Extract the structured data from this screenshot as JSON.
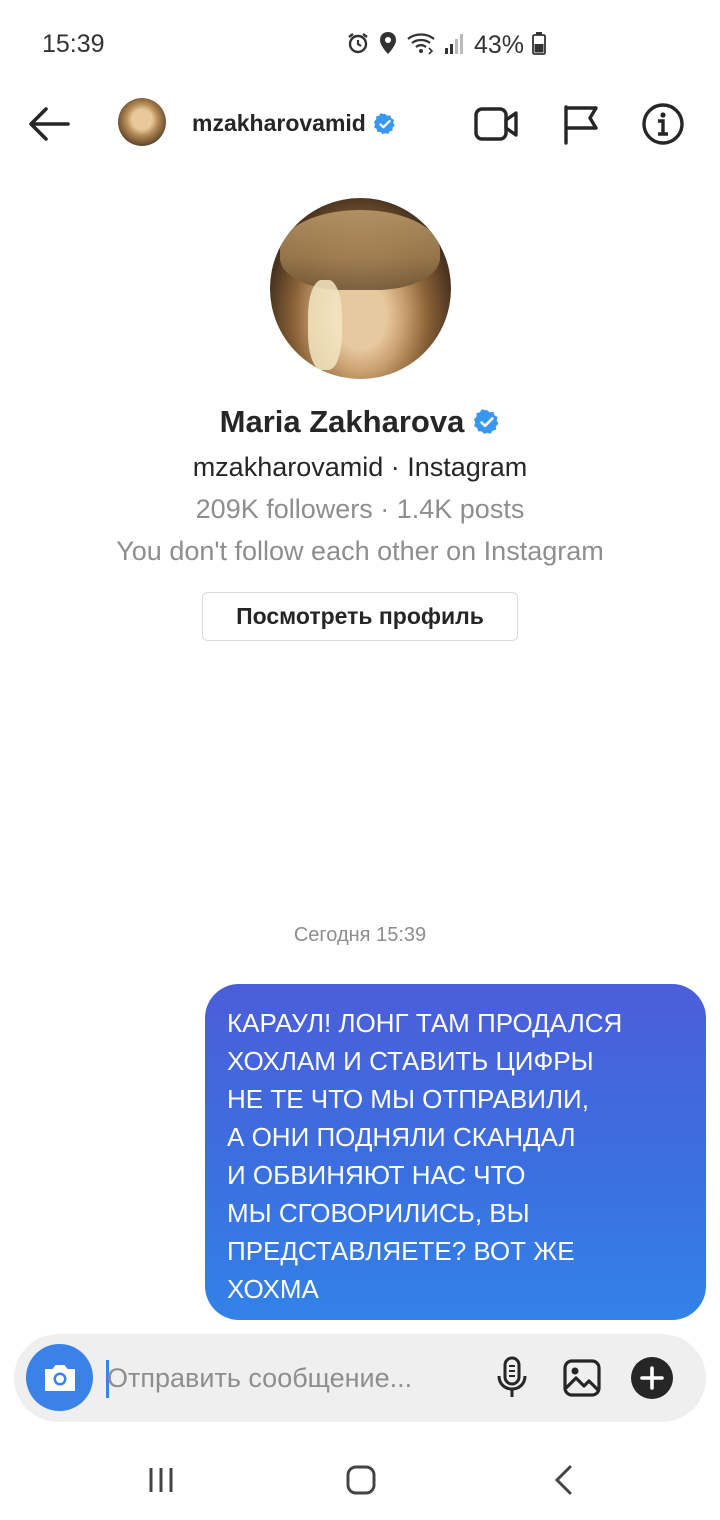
{
  "status_bar": {
    "time": "15:39",
    "battery": "43%",
    "icons": [
      "alarm-icon",
      "location-icon",
      "wifi-icon",
      "signal-icon",
      "battery-icon"
    ]
  },
  "header": {
    "username": "mzakharovamid",
    "icons": [
      "back-arrow-icon",
      "video-call-icon",
      "flag-icon",
      "info-icon"
    ]
  },
  "profile": {
    "full_name": "Maria Zakharova",
    "subtitle": "mzakharovamid · Instagram",
    "stats": "209K followers · 1.4K posts",
    "follow_status": "You don't follow each other on Instagram",
    "view_profile_label": "Посмотреть профиль"
  },
  "chat": {
    "timestamp": "Сегодня 15:39",
    "messages": [
      {
        "from": "me",
        "text": "КАРАУЛ! ЛОНГ ТАМ ПРОДАЛСЯ\nХОХЛАМ И СТАВИТЬ ЦИФРЫ\nНЕ ТЕ ЧТО МЫ ОТПРАВИЛИ,\nА ОНИ ПОДНЯЛИ СКАНДАЛ\nИ ОБВИНЯЮТ НАС ЧТО\nМЫ СГОВОРИЛИСЬ, ВЫ\nПРЕДСТАВЛЯЕТЕ? ВОТ ЖЕ\nХОХМА"
      }
    ]
  },
  "composer": {
    "placeholder": "Отправить сообщение...",
    "icons": [
      "camera-icon",
      "microphone-icon",
      "gallery-icon",
      "plus-icon"
    ]
  },
  "colors": {
    "accent": "#3b82e8",
    "bubble_top": "#4b5ed9",
    "bubble_bottom": "#3282e8",
    "verified": "#3897f0",
    "muted_text": "#8e8e8e"
  }
}
